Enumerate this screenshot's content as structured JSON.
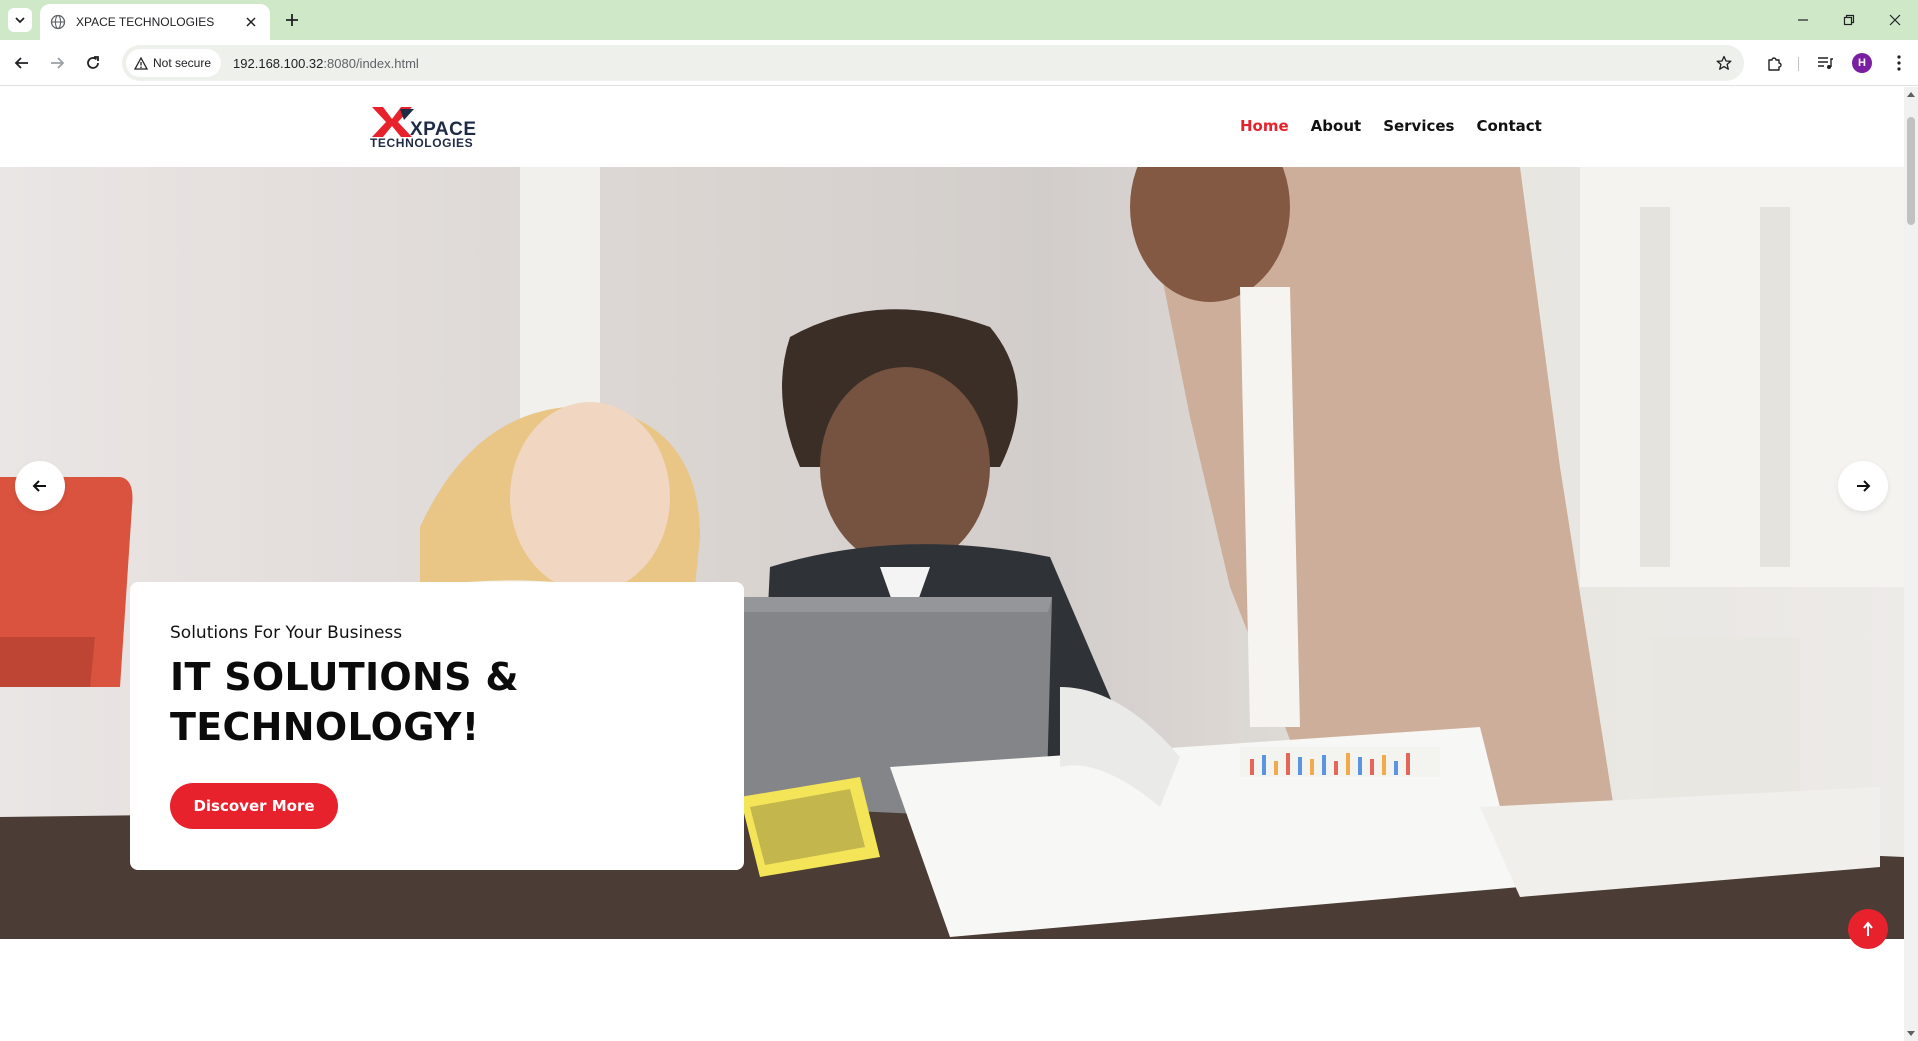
{
  "browser": {
    "tab_title": "XPACE TECHNOLOGIES",
    "security_label": "Not secure",
    "url_host": "192.168.100.32",
    "url_rest": ":8080/index.html",
    "profile_initial": "H"
  },
  "site": {
    "logo_word": "XPACE",
    "logo_sub": "TECHNOLOGIES",
    "nav": [
      {
        "label": "Home",
        "active": true
      },
      {
        "label": "About",
        "active": false
      },
      {
        "label": "Services",
        "active": false
      },
      {
        "label": "Contact",
        "active": false
      }
    ],
    "hero": {
      "subtitle": "Solutions For Your Business",
      "title_line1": "IT SOLUTIONS &",
      "title_line2": "TECHNOLOGY!",
      "cta_label": "Discover More"
    }
  },
  "colors": {
    "accent": "#e8222d",
    "tab_strip": "#cfe8c8",
    "logo_text": "#1f2a44"
  }
}
